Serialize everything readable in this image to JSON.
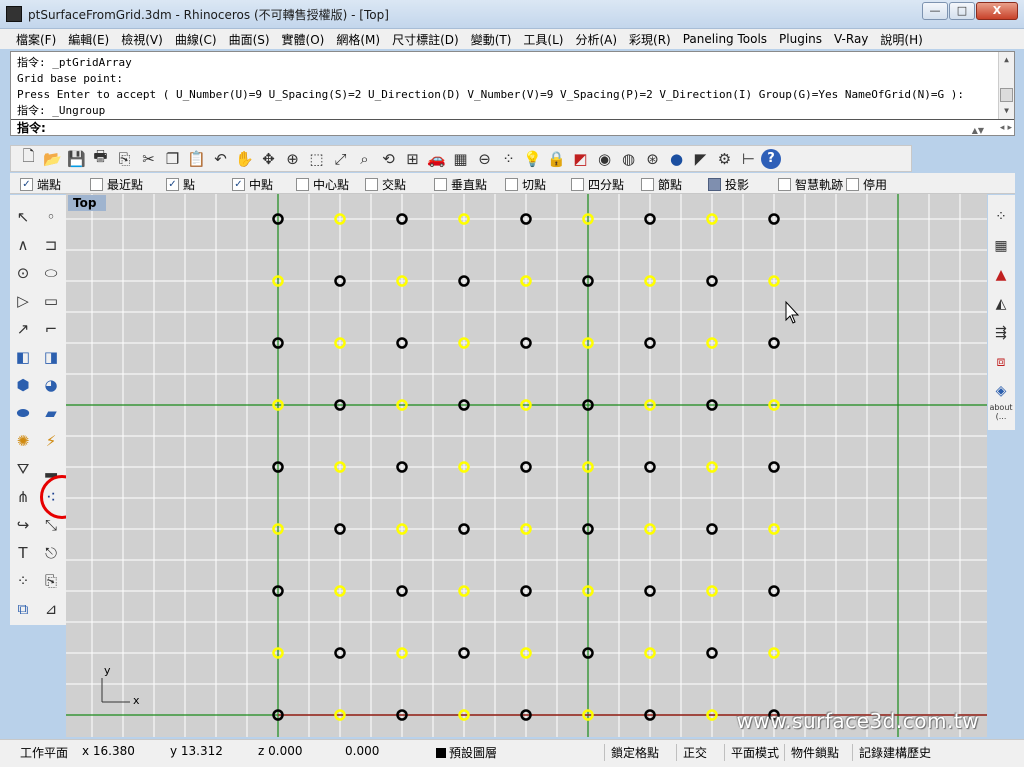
{
  "window": {
    "title": "ptSurfaceFromGrid.3dm - Rhinoceros (不可轉售授權版) - [Top]",
    "buttons": {
      "minimize": "—",
      "maximize": "□",
      "close": "X"
    }
  },
  "menu": [
    "檔案(F)",
    "編輯(E)",
    "檢視(V)",
    "曲線(C)",
    "曲面(S)",
    "實體(O)",
    "網格(M)",
    "尺寸標註(D)",
    "變動(T)",
    "工具(L)",
    "分析(A)",
    "彩現(R)",
    "Paneling Tools",
    "Plugins",
    "V-Ray",
    "說明(H)"
  ],
  "command": {
    "history": [
      "指令: _ptGridArray",
      "Grid base point:",
      "Press Enter to accept ( U_Number(U)=9  U_Spacing(S)=2  U_Direction(D)  V_Number(V)=9  V_Spacing(P)=2  V_Direction(I)  Group(G)=Yes  NameOfGrid(N)=G ):",
      "指令: _Ungroup"
    ],
    "prompt": "指令:"
  },
  "toolbar_icons": [
    "new-file-icon",
    "open-folder-icon",
    "save-icon",
    "print-icon",
    "import-icon",
    "cut-icon",
    "copy-icon",
    "paste-icon",
    "undo-icon",
    "pan-hand-icon",
    "rotate-view-icon",
    "zoom-icon",
    "zoom-window-icon",
    "zoom-extents-icon",
    "zoom-selected-icon",
    "undo-view-icon",
    "four-viewports-icon",
    "car-icon",
    "grid-options-icon",
    "construction-plane-icon",
    "pick-points-icon",
    "light-bulb-icon",
    "lock-icon",
    "properties-icon",
    "color-wheel-icon",
    "shaded-sphere-icon",
    "rendered-sphere-icon",
    "blue-sphere-icon",
    "paneling-icon",
    "settings-gear-icon",
    "dimension-icon",
    "help-icon"
  ],
  "osnaps": [
    {
      "label": "端點",
      "checked": true
    },
    {
      "label": "最近點",
      "checked": false
    },
    {
      "label": "點",
      "checked": true
    },
    {
      "label": "中點",
      "checked": true
    },
    {
      "label": "中心點",
      "checked": false
    },
    {
      "label": "交點",
      "checked": false
    },
    {
      "label": "垂直點",
      "checked": false
    },
    {
      "label": "切點",
      "checked": false
    },
    {
      "label": "四分點",
      "checked": false
    },
    {
      "label": "節點",
      "checked": false
    },
    {
      "label": "投影",
      "checked": true
    },
    {
      "label": "智慧軌跡",
      "checked": false
    },
    {
      "label": "停用",
      "checked": false
    }
  ],
  "left_tools": [
    "select-arrow-icon",
    "point-icon",
    "polyline-icon",
    "rectangle-icon",
    "circle-icon",
    "ellipse-icon",
    "polygon-icon",
    "rectangle-tool-icon",
    "curve-from-object-icon",
    "fillet-curve-icon",
    "surface-patch-icon",
    "surface-edit-icon",
    "solid-box-icon",
    "solid-sphere-icon",
    "cylinder-icon",
    "planar-surface-icon",
    "transform-icon",
    "flow-icon",
    "boolean-icon",
    "cplane-icon",
    "explode-icon",
    "point-cloud-icon",
    "fillet-edge-icon",
    "scale-icon",
    "text-object-icon",
    "blend-icon",
    "array-icon",
    "project-icon",
    "mesh-box-icon",
    "dimension-tool-icon"
  ],
  "highlighted_tool": "point-cloud-icon",
  "right_tools": [
    "control-points-icon",
    "grid-points-icon",
    "red-triangle-icon",
    "pyramid-icon",
    "axis-array-icon",
    "cube-grid-icon",
    "diamond-icon"
  ],
  "right_about_label": "about\n(...",
  "viewport": {
    "name": "Top",
    "axis_x": "x",
    "axis_y": "y",
    "watermark": "www.surface3d.com.tw",
    "grid": {
      "rows": 9,
      "cols": 9,
      "pattern": "checkerboard",
      "even_color": "#000000",
      "odd_color": "#ffff00"
    },
    "colors": {
      "background": "#d0d0d0",
      "grid_line": "#ffffff",
      "y_axis": "#1a8a1a",
      "x_axis": "#a02020"
    }
  },
  "status": {
    "cplane": "工作平面",
    "x": "x 16.380",
    "y": "y 13.312",
    "z": "z 0.000",
    "dist": "0.000",
    "layer": "預設圖層",
    "snap": "鎖定格點",
    "ortho": "正交",
    "planar": "平面模式",
    "osnap": "物件鎖點",
    "history": "記錄建構歷史"
  }
}
